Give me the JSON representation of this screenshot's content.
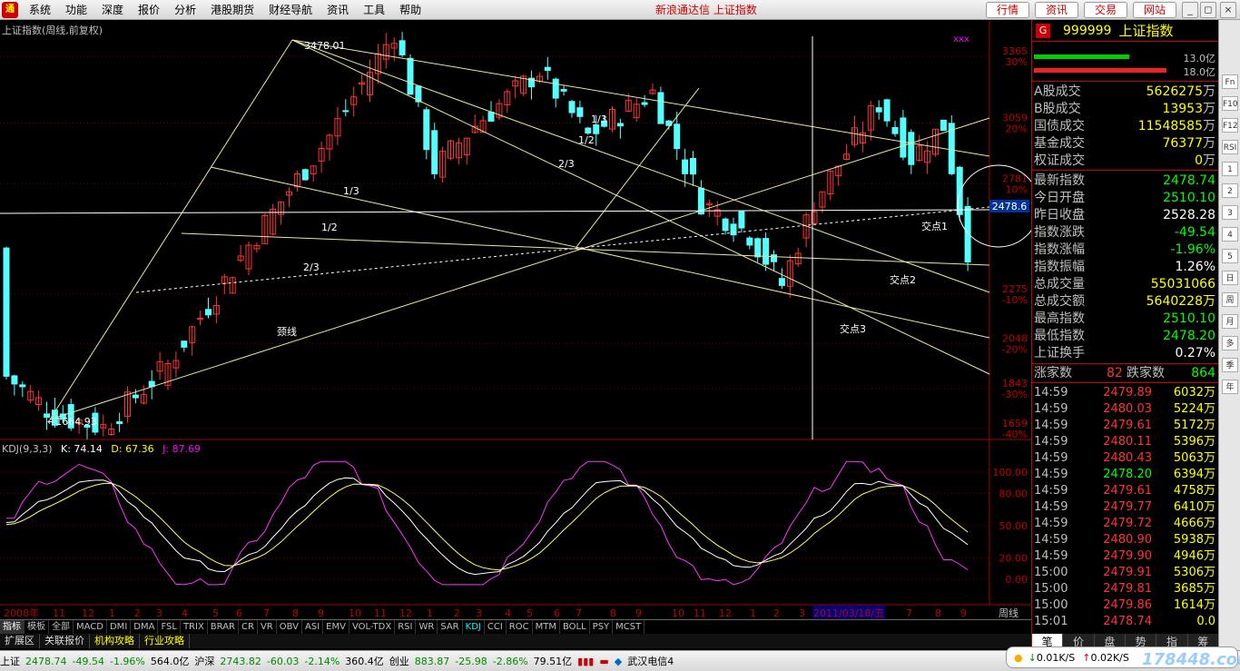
{
  "menu": {
    "items": [
      "系统",
      "功能",
      "深度",
      "报价",
      "分析",
      "港股期货",
      "财经导航",
      "资讯",
      "工具",
      "帮助"
    ],
    "app_title": "新浪通达信  上证指数",
    "top_buttons": [
      "行情",
      "资讯",
      "交易",
      "网站"
    ],
    "window_buttons": [
      "_",
      "◻",
      "×"
    ]
  },
  "chart": {
    "title": "上证指数(周线,前复权)",
    "marker": "xxx",
    "price_labels": [
      {
        "price": "3365",
        "pct": "30%"
      },
      {
        "price": "3059",
        "pct": "20%"
      },
      {
        "price": "2781",
        "pct": "10%"
      },
      {
        "price": "2275",
        "pct": "-10%"
      },
      {
        "price": "2048",
        "pct": "-20%"
      },
      {
        "price": "1843",
        "pct": "-30%"
      },
      {
        "price": "1659",
        "pct": "-40%"
      }
    ],
    "current_price_tag": "2478.6",
    "high_label": "3478.01",
    "low_label": "←1664.93",
    "annotations": [
      "1/3",
      "1/2",
      "2/3",
      "2/3",
      "1/2",
      "1/3",
      "颈线",
      "交点1",
      "交点2",
      "交点3"
    ],
    "time_labels": [
      "2008年",
      "11",
      "12",
      "1",
      "2",
      "3",
      "4",
      "5",
      "6",
      "7",
      "8",
      "9",
      "10",
      "11",
      "12",
      "1",
      "2",
      "3",
      "4",
      "5",
      "6",
      "7",
      "8",
      "9",
      "10",
      "11",
      "12",
      "1",
      "2",
      "3",
      "2011/03/18/五",
      "7",
      "8",
      "9"
    ],
    "period_label": "周线"
  },
  "kdj": {
    "name": "KDJ(9,3,3)",
    "k": "K: 74.14",
    "d": "D: 67.36",
    "j": "J: 87.69",
    "levels": [
      "100.00",
      "80.00",
      "50.00",
      "20.00",
      "0.00"
    ]
  },
  "indicator_tabs": [
    "指标",
    "模板",
    "全部",
    "MACD",
    "DMI",
    "DMA",
    "FSL",
    "TRIX",
    "BRAR",
    "CR",
    "VR",
    "OBV",
    "ASI",
    "EMV",
    "VOL-TDX",
    "RSI",
    "WR",
    "SAR",
    "KDJ",
    "CCI",
    "ROC",
    "MTM",
    "BOLL",
    "PSY",
    "MCST"
  ],
  "sub_tabs": [
    "扩展区",
    "关联报价",
    "机构攻略",
    "行业攻略"
  ],
  "status": {
    "sh_name": "上证",
    "sh_price": "2478.74",
    "sh_chg": "-49.54",
    "sh_pct": "-1.96%",
    "sh_amt": "564.0亿",
    "sz_name": "沪深",
    "sz_price": "2743.82",
    "sz_chg": "-60.03",
    "sz_pct": "-2.14%",
    "sz_amt": "360.4亿",
    "cy_name": "创业",
    "cy_price": "883.87",
    "cy_chg": "-25.98",
    "cy_pct": "-2.86%",
    "cy_amt": "79.51亿",
    "news": "武汉电信4",
    "down_speed": "0.01K/S",
    "up_speed": "0.02K/S",
    "watermark": "178448.com"
  },
  "quote": {
    "icon": "G",
    "code": "999999",
    "name": "上证指数",
    "bar1": "13.0亿",
    "bar2": "18.0亿",
    "rows1": [
      {
        "label": "A股成交",
        "value": "5626275",
        "unit": "万"
      },
      {
        "label": "B股成交",
        "value": "13953",
        "unit": "万"
      },
      {
        "label": "国债成交",
        "value": "11548585",
        "unit": "万"
      },
      {
        "label": "基金成交",
        "value": "76377",
        "unit": "万"
      },
      {
        "label": "权证成交",
        "value": "0",
        "unit": "万"
      }
    ],
    "rows2": [
      {
        "label": "最新指数",
        "value": "2478.74",
        "color": "#00ff00"
      },
      {
        "label": "今日开盘",
        "value": "2510.10",
        "color": "#00ff00"
      },
      {
        "label": "昨日收盘",
        "value": "2528.28",
        "color": "#ffffff"
      },
      {
        "label": "指数涨跌",
        "value": "-49.54",
        "color": "#00ff00"
      },
      {
        "label": "指数涨幅",
        "value": "-1.96%",
        "color": "#00ff00"
      },
      {
        "label": "指数振幅",
        "value": "1.26%",
        "color": "#ffffff"
      },
      {
        "label": "总成交量",
        "value": "55031066",
        "color": "#ffff00"
      },
      {
        "label": "总成交额",
        "value": "5640228万",
        "color": "#ffff00"
      },
      {
        "label": "最高指数",
        "value": "2510.10",
        "color": "#00ff00"
      },
      {
        "label": "最低指数",
        "value": "2478.20",
        "color": "#00ff00"
      },
      {
        "label": "上证换手",
        "value": "0.27%",
        "color": "#ffffff"
      }
    ],
    "up_label": "涨家数",
    "up_count": "82",
    "down_label": "跌家数",
    "down_count": "864",
    "ticks": [
      {
        "time": "14:59",
        "price": "2479.89",
        "vol": "6032万"
      },
      {
        "time": "14:59",
        "price": "2480.03",
        "vol": "5224万"
      },
      {
        "time": "14:59",
        "price": "2479.61",
        "vol": "5172万"
      },
      {
        "time": "14:59",
        "price": "2480.11",
        "vol": "5396万"
      },
      {
        "time": "14:59",
        "price": "2480.43",
        "vol": "5063万"
      },
      {
        "time": "14:59",
        "price": "2478.20",
        "vol": "6394万"
      },
      {
        "time": "14:59",
        "price": "2479.61",
        "vol": "4758万"
      },
      {
        "time": "14:59",
        "price": "2479.77",
        "vol": "6410万"
      },
      {
        "time": "14:59",
        "price": "2479.72",
        "vol": "4666万"
      },
      {
        "time": "14:59",
        "price": "2480.90",
        "vol": "5938万"
      },
      {
        "time": "14:59",
        "price": "2479.90",
        "vol": "4946万"
      },
      {
        "time": "15:00",
        "price": "2479.91",
        "vol": "5306万"
      },
      {
        "time": "15:00",
        "price": "2479.81",
        "vol": "3685万"
      },
      {
        "time": "15:00",
        "price": "2479.86",
        "vol": "1614万"
      },
      {
        "time": "15:01",
        "price": "2478.74",
        "vol": "0.0"
      }
    ],
    "bottom_tabs": [
      "笔",
      "价",
      "盘",
      "势",
      "指",
      "筹"
    ]
  },
  "right_toolbar": [
    "Fn",
    "F10",
    "F12",
    "RSI",
    "1",
    "2",
    "3",
    "4",
    "5",
    "日",
    "周",
    "月",
    "多",
    "季",
    "年"
  ]
}
